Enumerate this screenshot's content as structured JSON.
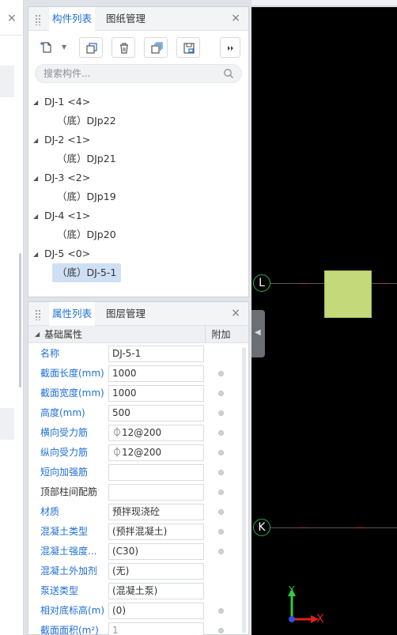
{
  "component_panel": {
    "tabs": [
      {
        "label": "构件列表",
        "active": true
      },
      {
        "label": "图纸管理",
        "active": false
      }
    ],
    "close_label": "×",
    "search": {
      "placeholder": "搜索构件..."
    },
    "tree": [
      {
        "group": "DJ-1 <4>",
        "children": [
          "（底）DJp22"
        ]
      },
      {
        "group": "DJ-2 <1>",
        "children": [
          "（底）DJp21"
        ]
      },
      {
        "group": "DJ-3 <2>",
        "children": [
          "（底）DJp19"
        ]
      },
      {
        "group": "DJ-4 <1>",
        "children": [
          "（底）DJp20"
        ]
      },
      {
        "group": "DJ-5 <0>",
        "children": [
          "（底）DJ-5-1"
        ]
      }
    ],
    "selected_item": "（底）DJ-5-1"
  },
  "property_panel": {
    "tabs": [
      {
        "label": "属性列表",
        "active": true
      },
      {
        "label": "图层管理",
        "active": false
      }
    ],
    "close_label": "×",
    "section_title": "基础属性",
    "extra_column": "附加",
    "rows": [
      {
        "label": "名称",
        "value": "DJ-5-1",
        "blue": true,
        "dot": false
      },
      {
        "label": "截面长度(mm)",
        "value": "1000",
        "blue": true,
        "dot": true
      },
      {
        "label": "截面宽度(mm)",
        "value": "1000",
        "blue": true,
        "dot": true
      },
      {
        "label": "高度(mm)",
        "value": "500",
        "blue": true,
        "dot": true
      },
      {
        "label": "横向受力筋",
        "value": "⏀12@200",
        "blue": true,
        "dot": true
      },
      {
        "label": "纵向受力筋",
        "value": "⏀12@200",
        "blue": true,
        "dot": true
      },
      {
        "label": "短向加强筋",
        "value": "",
        "blue": true,
        "dot": true
      },
      {
        "label": "顶部柱间配筋",
        "value": "",
        "blue": false,
        "dot": true
      },
      {
        "label": "材质",
        "value": "预拌现浇砼",
        "blue": true,
        "dot": true
      },
      {
        "label": "混凝土类型",
        "value": "(预拌混凝土)",
        "blue": true,
        "dot": true
      },
      {
        "label": "混凝土强度...",
        "value": "(C30)",
        "blue": true,
        "dot": true
      },
      {
        "label": "混凝土外加剂",
        "value": "(无)",
        "blue": true,
        "dot": false
      },
      {
        "label": "泵送类型",
        "value": "(混凝土泵)",
        "blue": true,
        "dot": false
      },
      {
        "label": "相对底标高(m)",
        "value": "(0)",
        "blue": true,
        "dot": true
      },
      {
        "label": "截面面积(m²)",
        "value": "1",
        "blue": true,
        "dot": true,
        "grey": true
      }
    ]
  },
  "canvas": {
    "axis_labels": [
      "L",
      "K"
    ],
    "coord_axes": [
      "Y",
      "X"
    ],
    "colors": {
      "background": "#000000",
      "column": "#c4d97a",
      "axis_ring": "#27b24a",
      "y_axis": "#2ecc40",
      "x_axis": "#e02020"
    }
  },
  "left_strip": {
    "close_label": "×"
  }
}
